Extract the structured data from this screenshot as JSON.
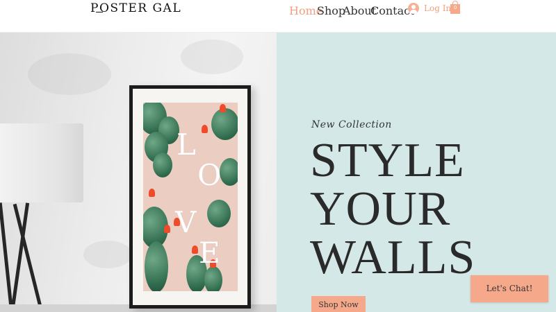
{
  "brand": {
    "name": "POSTER GAL"
  },
  "nav": {
    "items": [
      {
        "label": "Home",
        "active": true
      },
      {
        "label": "Shop",
        "active": false
      },
      {
        "label": "About",
        "active": false
      },
      {
        "label": "Contact",
        "active": false
      }
    ],
    "login_label": "Log In",
    "cart_count": "0",
    "accent_color": "#f0a080"
  },
  "hero": {
    "poster_letters": [
      "L",
      "O",
      "V",
      "E"
    ],
    "eyebrow": "New Collection",
    "headline_lines": [
      "STYLE",
      "YOUR",
      "WALLS"
    ],
    "cta_label": "Shop Now",
    "panel_color": "#d5e8e8"
  },
  "chat": {
    "label": "Let's Chat!"
  },
  "colors": {
    "button": "#f5a98a",
    "text": "#2a2a2a"
  },
  "icons": {
    "avatar": "user-avatar-icon",
    "cart": "shopping-bag-icon"
  }
}
